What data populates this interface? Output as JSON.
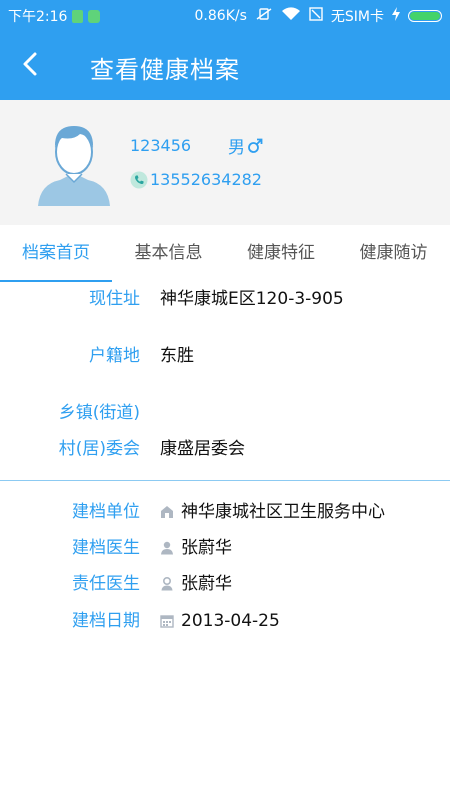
{
  "status_bar": {
    "time": "下午2:16",
    "net_speed": "0.86K/s",
    "sim": "无SIM卡"
  },
  "header": {
    "title": "查看健康档案"
  },
  "profile": {
    "id": "123456",
    "gender": "男",
    "phone": "13552634282"
  },
  "tabs": [
    {
      "label": "档案首页",
      "active": true
    },
    {
      "label": "基本信息",
      "active": false
    },
    {
      "label": "健康特征",
      "active": false
    },
    {
      "label": "健康随访",
      "active": false
    }
  ],
  "address": {
    "current_label": "现住址",
    "current_value": "神华康城E区120-3-905",
    "household_label": "户籍地",
    "household_value": "东胜",
    "town_label": "乡镇(街道)",
    "town_value": "",
    "village_label": "村(居)委会",
    "village_value": "康盛居委会"
  },
  "record": {
    "unit_label": "建档单位",
    "unit_value": "神华康城社区卫生服务中心",
    "doctor_label": "建档医生",
    "doctor_value": "张蔚华",
    "resp_label": "责任医生",
    "resp_value": "张蔚华",
    "date_label": "建档日期",
    "date_value": "2013-04-25"
  },
  "colors": {
    "primary": "#2f9ff0",
    "profile_bg": "#f4f4f4"
  },
  "icons": [
    "back-arrow-icon",
    "avatar-icon",
    "male-icon",
    "phone-icon",
    "building-icon",
    "doctor-icon",
    "person-icon",
    "calendar-icon"
  ]
}
